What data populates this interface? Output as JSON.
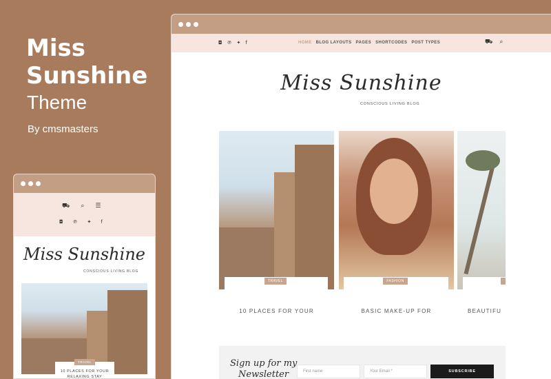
{
  "promo": {
    "title_line1": "Miss",
    "title_line2": "Sunshine",
    "subtitle": "Theme",
    "byline": "By cmsmasters"
  },
  "desktop": {
    "social_icons": [
      "instagram-icon",
      "pinterest-icon",
      "twitter-icon",
      "facebook-icon"
    ],
    "social_glyphs": [
      "◘",
      "℗",
      "✦",
      "f"
    ],
    "menu": [
      {
        "label": "HOME",
        "active": true
      },
      {
        "label": "BLOG LAYOUTS",
        "active": false
      },
      {
        "label": "PAGES",
        "active": false
      },
      {
        "label": "SHORTCODES",
        "active": false
      },
      {
        "label": "POST TYPES",
        "active": false
      }
    ],
    "cart_glyph": "⛟",
    "search_glyph": "⌕",
    "logo": "Miss Sunshine",
    "tagline": "CONSCIOUS LIVING BLOG",
    "posts": [
      {
        "tag": "TRAVEL",
        "title": "10 PLACES FOR YOUR"
      },
      {
        "tag": "FASHION",
        "title": "BASIC MAKE-UP FOR"
      },
      {
        "tag": "",
        "title": "BEAUTIFU"
      }
    ],
    "newsletter": {
      "script_line1": "Sign up for my",
      "script_line2": "Newsletter",
      "first_name_placeholder": "First name",
      "email_placeholder": "Your Email *",
      "button_label": "SUBSCRIBE"
    }
  },
  "mobile": {
    "cart_glyph": "⛟",
    "search_glyph": "⌕",
    "menu_glyph": "☰",
    "social_glyphs": [
      "◘",
      "℗",
      "✦",
      "f"
    ],
    "logo": "Miss Sunshine",
    "tagline": "CONSCIOUS LIVING BLOG",
    "post": {
      "tag": "TRAVEL",
      "title": "10 PLACES FOR YOUR RELAXING STAY"
    }
  },
  "colors": {
    "background": "#a87b5c",
    "window_bar": "#c39e85",
    "nav_bg": "#f7e6df",
    "accent": "#c7a58f",
    "button": "#1b1b1b"
  }
}
